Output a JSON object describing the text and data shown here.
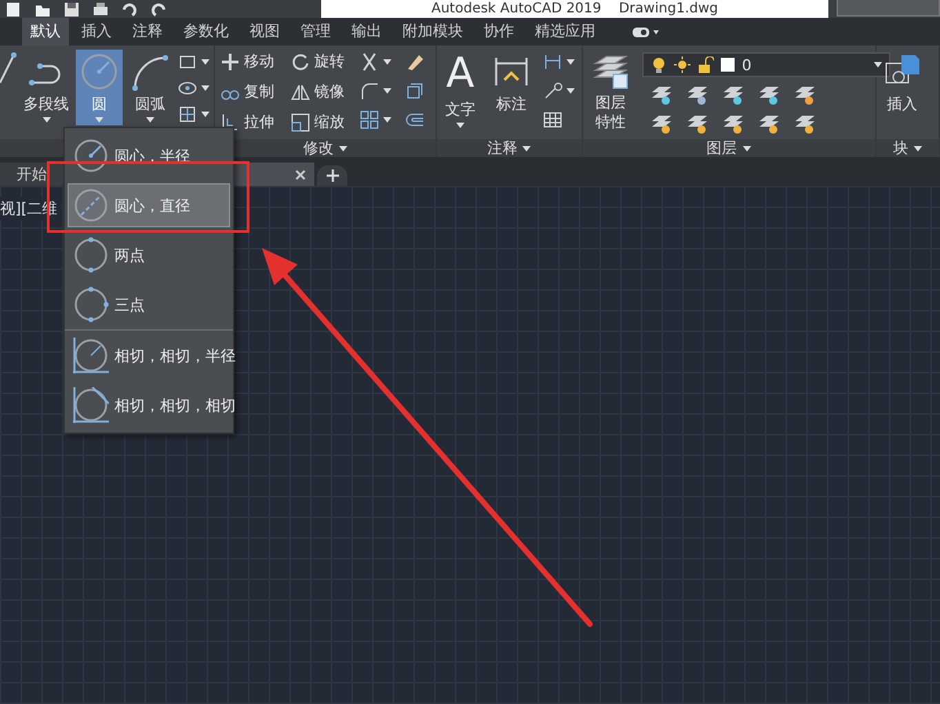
{
  "title_bar": {
    "title": "Autodesk AutoCAD 2019    Drawing1.dwg"
  },
  "ribbon_tabs": [
    {
      "label": "默认",
      "selected": true
    },
    {
      "label": "插入",
      "selected": false
    },
    {
      "label": "注释",
      "selected": false
    },
    {
      "label": "参数化",
      "selected": false
    },
    {
      "label": "视图",
      "selected": false
    },
    {
      "label": "管理",
      "selected": false
    },
    {
      "label": "输出",
      "selected": false
    },
    {
      "label": "附加模块",
      "selected": false
    },
    {
      "label": "协作",
      "selected": false
    },
    {
      "label": "精选应用",
      "selected": false
    }
  ],
  "ribbon": {
    "draw": {
      "buttons": [
        {
          "label": "多段线",
          "selected": false
        },
        {
          "label": "圆",
          "selected": true
        },
        {
          "label": "圆弧",
          "selected": false
        }
      ]
    },
    "modify": {
      "label": "修改",
      "tools": [
        "移动",
        "旋转",
        "复制",
        "镜像",
        "拉伸",
        "缩放"
      ]
    },
    "annotation": {
      "label": "注释",
      "text_glyph": "A",
      "tools": [
        "文字",
        "标注"
      ]
    },
    "layers": {
      "label": "图层",
      "properties": "图层特性",
      "current_layer": "0"
    },
    "block": {
      "label": "块",
      "tools": [
        "插入"
      ]
    }
  },
  "file_tabs": [
    {
      "label": "开始",
      "selected": false
    }
  ],
  "viewport": {
    "label": "视][二维"
  },
  "circle_menu": {
    "groups": [
      {
        "items": [
          {
            "kind": "center-radius",
            "label": "圆心，半径",
            "selected": false
          },
          {
            "kind": "center-diameter",
            "label": "圆心，直径",
            "selected": true
          },
          {
            "kind": "two-point",
            "label": "两点",
            "selected": false
          },
          {
            "kind": "three-point",
            "label": "三点",
            "selected": false
          }
        ]
      },
      {
        "items": [
          {
            "kind": "tan-tan-radius",
            "label": "相切，相切，半径",
            "selected": false
          },
          {
            "kind": "tan-tan-tan",
            "label": "相切，相切，相切",
            "selected": false
          }
        ]
      }
    ]
  }
}
